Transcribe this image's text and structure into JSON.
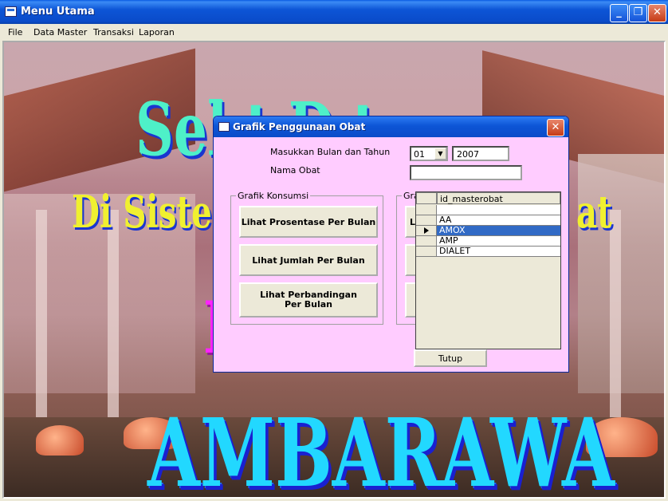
{
  "window": {
    "title": "Menu Utama"
  },
  "menu": [
    "File",
    "Data Master",
    "Transaksi",
    "Laporan"
  ],
  "background": {
    "line1": "Sel      t D   t",
    "line2_left": "Di Sistem",
    "line2_right": "at",
    "line3": "I",
    "line4": "AMBARAWA"
  },
  "dialog": {
    "title": "Grafik Penggunaan Obat",
    "month_year_label": "Masukkan Bulan dan Tahun",
    "month_value": "01",
    "year_value": "2007",
    "drug_name_label": "Nama Obat",
    "drug_name_value": "",
    "group_left_caption": "Grafik Konsumsi",
    "group_right_caption": "Gra",
    "btn_percent": "Lihat Prosentase Per Bulan",
    "btn_total": "Lihat Jumlah Per Bulan",
    "btn_compare": "Lihat Perbandingan Per Bulan",
    "right_btn_partial": "Li",
    "close_button": "Tutup"
  },
  "grid": {
    "column": "id_masterobat",
    "rows": [
      "",
      "AA",
      "AMOX",
      "AMP",
      "DIALET"
    ],
    "selected_index": 2
  },
  "colors": {
    "titlebar": "#0a4bc9",
    "dialog_bg": "#ffccff",
    "selection": "#316ac5"
  }
}
